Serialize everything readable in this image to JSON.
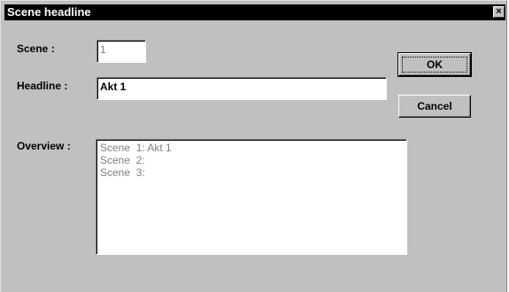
{
  "window": {
    "title": "Scene headline",
    "close_glyph": "×"
  },
  "form": {
    "scene_label": "Scene :",
    "scene_value": "1",
    "headline_label": "Headline :",
    "headline_value": "Akt 1",
    "overview_label": "Overview :",
    "overview_items": [
      "Scene  1: Akt 1",
      "Scene  2:",
      "Scene  3:"
    ]
  },
  "buttons": {
    "ok_label": "OK",
    "cancel_label": "Cancel"
  },
  "icons": {
    "close": "close-icon"
  }
}
